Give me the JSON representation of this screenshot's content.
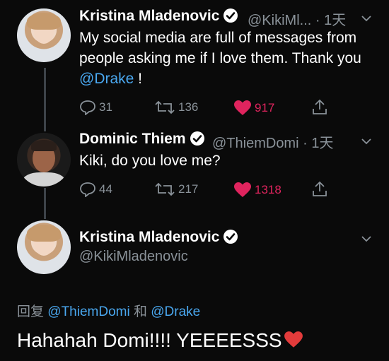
{
  "tweets": [
    {
      "name": "Kristina Mladenovic",
      "handle": "@KikiMl...",
      "time": "· 1天",
      "text_plain": "My social media are full of messages from people asking me if I love them. Thank you ",
      "mention": "@Drake",
      "text_after": " !",
      "replies": "31",
      "retweets": "136",
      "likes": "917",
      "liked": true
    },
    {
      "name": "Dominic Thiem",
      "handle": "@ThiemDomi",
      "time": "· 1天",
      "text_plain": "Kiki, do you love me?",
      "replies": "44",
      "retweets": "217",
      "likes": "1318",
      "liked": true
    }
  ],
  "focused": {
    "name": "Kristina Mladenovic",
    "handle": "@KikiMladenovic",
    "reply_prefix": "回复 ",
    "reply_mentions": [
      "@ThiemDomi",
      "@Drake"
    ],
    "reply_joiner": " 和 ",
    "text": "Hahahah Domi!!!! YEEEESSS"
  },
  "colors": {
    "background": "#0a0a0a",
    "link": "#4aa8f0",
    "like": "#e0245e",
    "muted": "#8a9299"
  },
  "icons": [
    "verified-icon",
    "chevron-down-icon",
    "reply-icon",
    "retweet-icon",
    "heart-icon",
    "share-icon",
    "red-heart-emoji"
  ]
}
